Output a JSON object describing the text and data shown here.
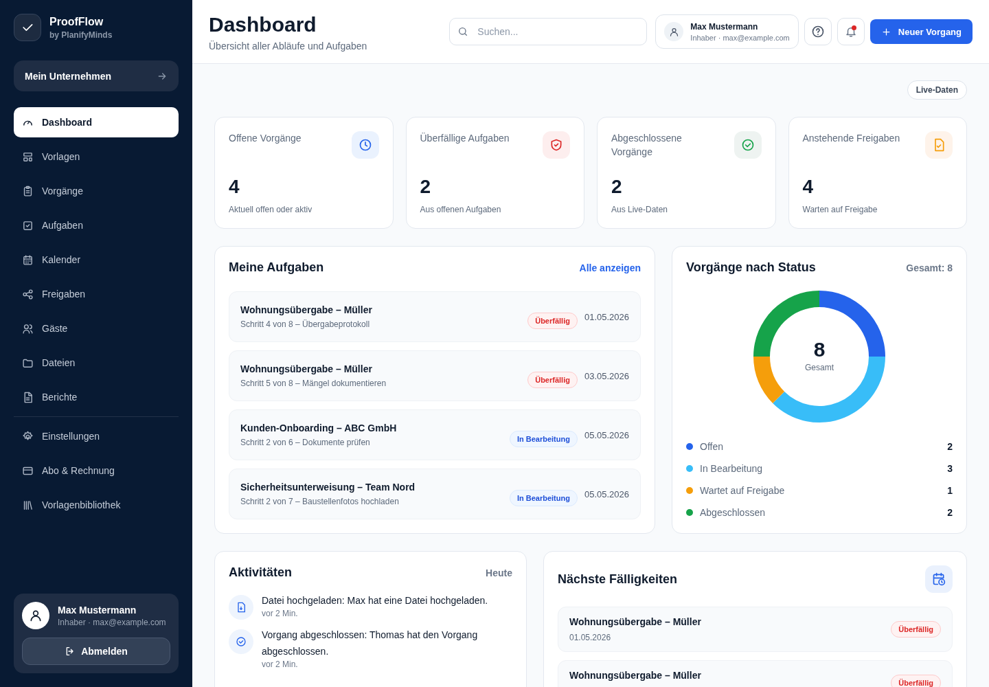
{
  "sidebar": {
    "brand": {
      "name": "ProofFlow",
      "tagline": "by PlanifyMinds"
    },
    "company_button": "Mein Unternehmen",
    "nav": [
      {
        "label": "Dashboard",
        "selected": true
      },
      {
        "label": "Vorlagen",
        "selected": false
      },
      {
        "label": "Vorgänge",
        "selected": false
      },
      {
        "label": "Aufgaben",
        "selected": false
      },
      {
        "label": "Kalender",
        "selected": false
      },
      {
        "label": "Freigaben",
        "selected": false
      },
      {
        "label": "Gäste",
        "selected": false
      },
      {
        "label": "Dateien",
        "selected": false
      },
      {
        "label": "Berichte",
        "selected": false
      }
    ],
    "settings_nav": [
      {
        "label": "Einstellungen",
        "selected": false
      },
      {
        "label": "Abo & Rechnung",
        "selected": false
      },
      {
        "label": "Vorlagenbibliothek",
        "selected": false
      }
    ],
    "user": {
      "name": "Max Mustermann",
      "role": "Inhaber · max@example.com",
      "logout": "Abmelden"
    }
  },
  "header": {
    "title": "Dashboard",
    "subtitle": "Übersicht aller Abläufe und Aufgaben",
    "search": {
      "placeholder": "Suchen..."
    },
    "user": {
      "name": "Max Mustermann",
      "role": "Inhaber · max@example.com"
    },
    "notifications_unread": true,
    "new_button": "Neuer Vorgang"
  },
  "live_badge": "Live-Daten",
  "stats": [
    {
      "kind": "open",
      "label": "Offene Vorgänge",
      "value": "4",
      "note": "Aktuell offen oder aktiv"
    },
    {
      "kind": "overdue",
      "label": "Überfällige Aufgaben",
      "value": "2",
      "note": "Aus offenen Aufgaben"
    },
    {
      "kind": "done",
      "label": "Abgeschlossene Vorgänge",
      "value": "2",
      "note": "Aus Live-Daten"
    },
    {
      "kind": "pending",
      "label": "Anstehende Freigaben",
      "value": "4",
      "note": "Warten auf Freigabe"
    }
  ],
  "tasks": {
    "title": "Meine Aufgaben",
    "link": "Alle anzeigen",
    "items": [
      {
        "title": "Wohnungsübergabe – Müller",
        "step": "Schritt 4 von 8 – Übergabeprotokoll",
        "kind": "overdue",
        "status_label": "Überfällig",
        "date": "01.05.2026"
      },
      {
        "title": "Wohnungsübergabe – Müller",
        "step": "Schritt 5 von 8 – Mängel dokumentieren",
        "kind": "overdue",
        "status_label": "Überfällig",
        "date": "03.05.2026"
      },
      {
        "title": "Kunden-Onboarding – ABC GmbH",
        "step": "Schritt 2 von 6 – Dokumente prüfen",
        "kind": "in_progress",
        "status_label": "In Bearbeitung",
        "date": "05.05.2026"
      },
      {
        "title": "Sicherheitsunterweisung – Team Nord",
        "step": "Schritt 2 von 7 – Baustellenfotos hochladen",
        "kind": "in_progress",
        "status_label": "In Bearbeitung",
        "date": "05.05.2026"
      }
    ]
  },
  "status_chart": {
    "title": "Vorgänge nach Status",
    "total_label": "Gesamt: 8",
    "center_value": "8",
    "center_label": "Gesamt",
    "chart_data": {
      "type": "donut",
      "values": [
        25,
        37.5,
        12.5,
        25
      ]
    },
    "legend": [
      {
        "label": "Offen",
        "count": "2",
        "color": "#2563eb"
      },
      {
        "label": "In Bearbeitung",
        "count": "3",
        "color": "#38bdf8"
      },
      {
        "label": "Wartet auf Freigabe",
        "count": "1",
        "color": "#f59e0b"
      },
      {
        "label": "Abgeschlossen",
        "count": "2",
        "color": "#16a34a"
      }
    ]
  },
  "activities": {
    "title": "Aktivitäten",
    "period": "Heute",
    "items": [
      {
        "kind": "upload",
        "text": "Datei hochgeladen: Max hat eine Datei hochgeladen.",
        "time": "vor 2 Min."
      },
      {
        "kind": "completed",
        "text": "Vorgang abgeschlossen: Thomas hat den Vorgang abgeschlossen.",
        "time": "vor 2 Min."
      }
    ]
  },
  "due": {
    "title": "Nächste Fälligkeiten",
    "items": [
      {
        "title": "Wohnungsübergabe – Müller",
        "date": "01.05.2026",
        "kind": "overdue",
        "status_label": "Überfällig"
      },
      {
        "title": "Wohnungsübergabe – Müller",
        "kind": "overdue",
        "status_label": "Überfällig"
      }
    ]
  }
}
